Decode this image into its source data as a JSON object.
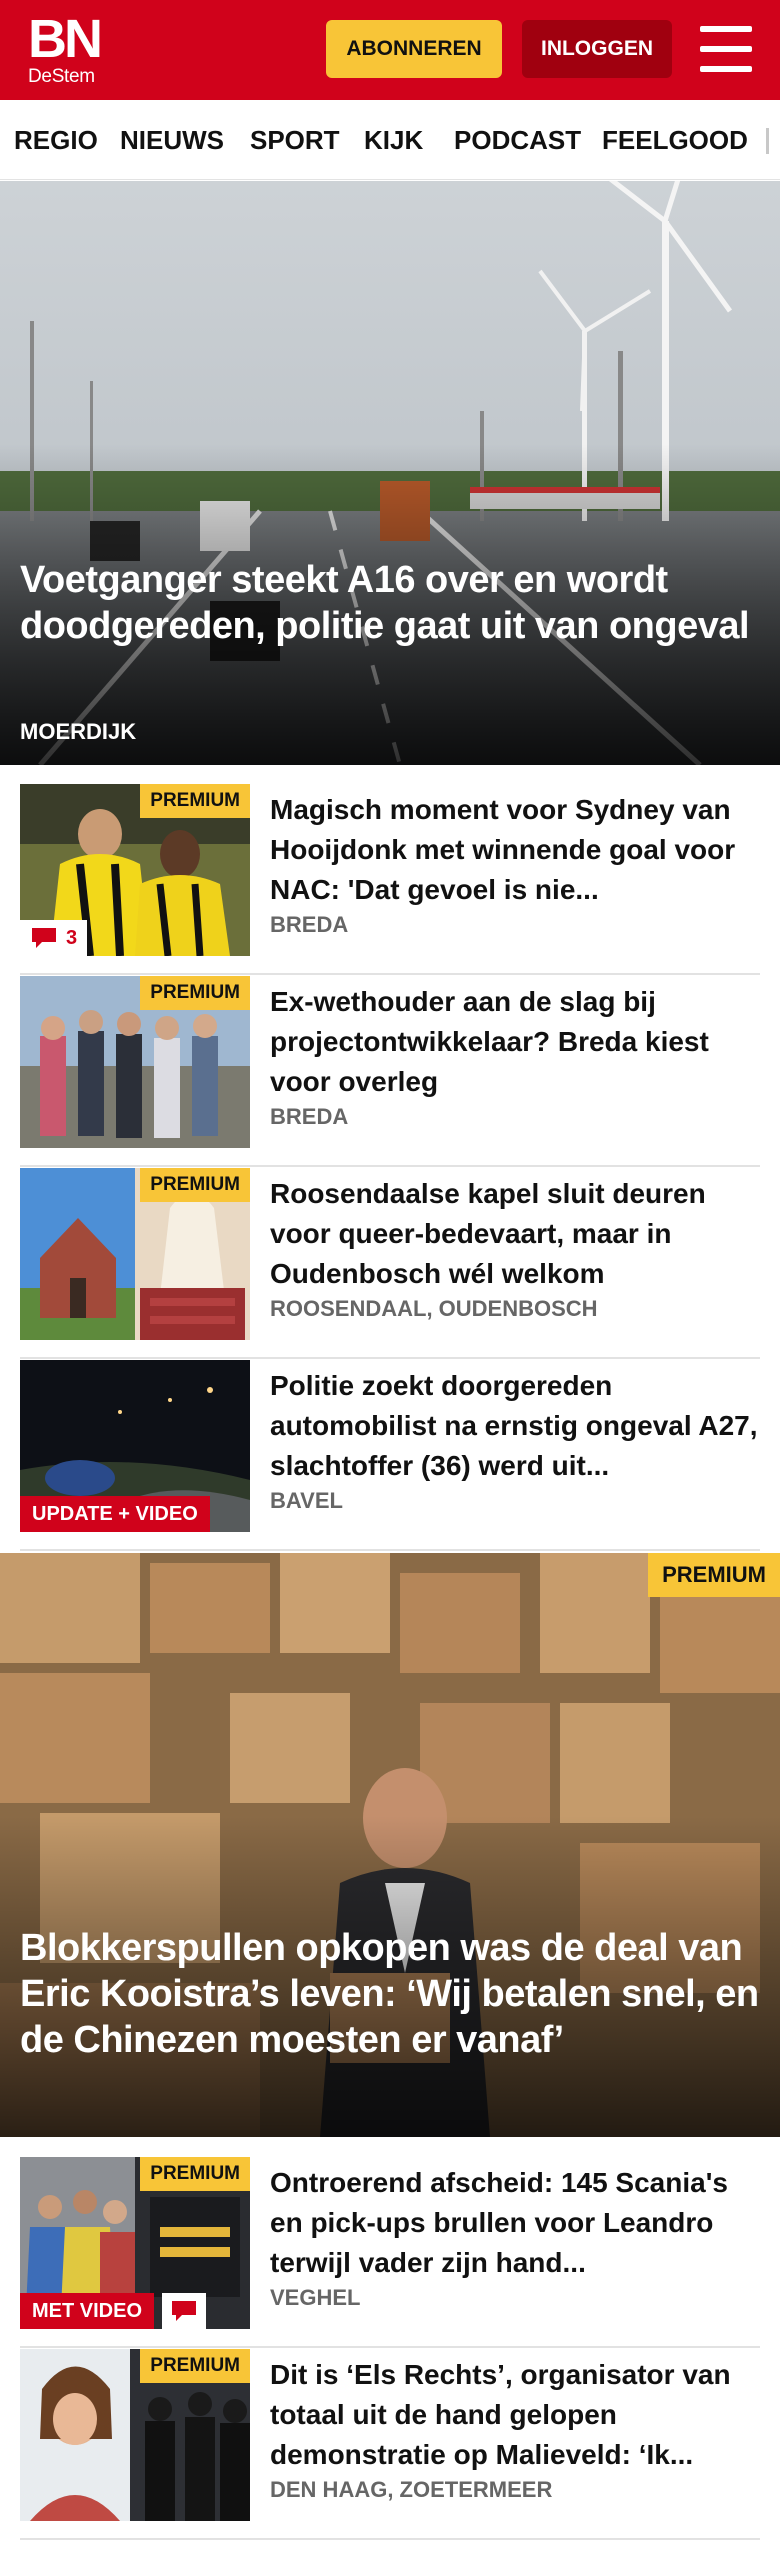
{
  "header": {
    "logo_main": "BN",
    "logo_sub": "DeStem",
    "subscribe_label": "ABONNEREN",
    "login_label": "INLOGGEN"
  },
  "nav": {
    "items": [
      "REGIO",
      "NIEUWS",
      "SPORT",
      "KIJK",
      "PODCAST",
      "FEELGOOD"
    ]
  },
  "hero": {
    "title": "Voetganger steekt A16 over en wordt doodgereden, politie gaat uit van ongeval",
    "location": "MOERDIJK"
  },
  "articles": [
    {
      "title": "Magisch moment voor Sydney van Hooijdonk met winnende goal voor NAC: 'Dat gevoel is nie...",
      "location": "BREDA",
      "premium": "PREMIUM",
      "comments": "3"
    },
    {
      "title": "Ex-wethouder aan de slag bij projectontwikkelaar? Breda kiest voor overleg",
      "location": "BREDA",
      "premium": "PREMIUM"
    },
    {
      "title": "Roosendaalse kapel sluit deuren voor queer-bedevaart, maar in Oudenbosch wél welkom",
      "location": "ROOSENDAAL, OUDENBOSCH",
      "premium": "PREMIUM"
    },
    {
      "title": "Politie zoekt doorgereden automobilist na ernstig ongeval A27, slachtoffer (36) werd uit...",
      "location": "BAVEL",
      "tag": "UPDATE + VIDEO"
    }
  ],
  "hero2": {
    "premium": "PREMIUM",
    "title": "Blokkerspullen opkopen was de deal van Eric Kooistra’s leven: ‘Wij betalen snel, en de Chinezen moesten er vanaf’"
  },
  "articles2": [
    {
      "title": "Ontroerend afscheid: 145 Scania's en pick-ups brullen voor Leandro terwijl vader zijn hand...",
      "location": "VEGHEL",
      "premium": "PREMIUM",
      "tag": "MET VIDEO"
    },
    {
      "title": "Dit is ‘Els Rechts’, organisator van totaal uit de hand gelopen demonstratie op Malieveld: ‘Ik...",
      "location": "DEN HAAG, ZOETERMEER",
      "premium": "PREMIUM"
    }
  ],
  "colors": {
    "brand_red": "#d0021b",
    "premium_yellow": "#f8c537",
    "login_dark_red": "#a0000f"
  },
  "icons": [
    "menu-icon",
    "comment-icon"
  ]
}
